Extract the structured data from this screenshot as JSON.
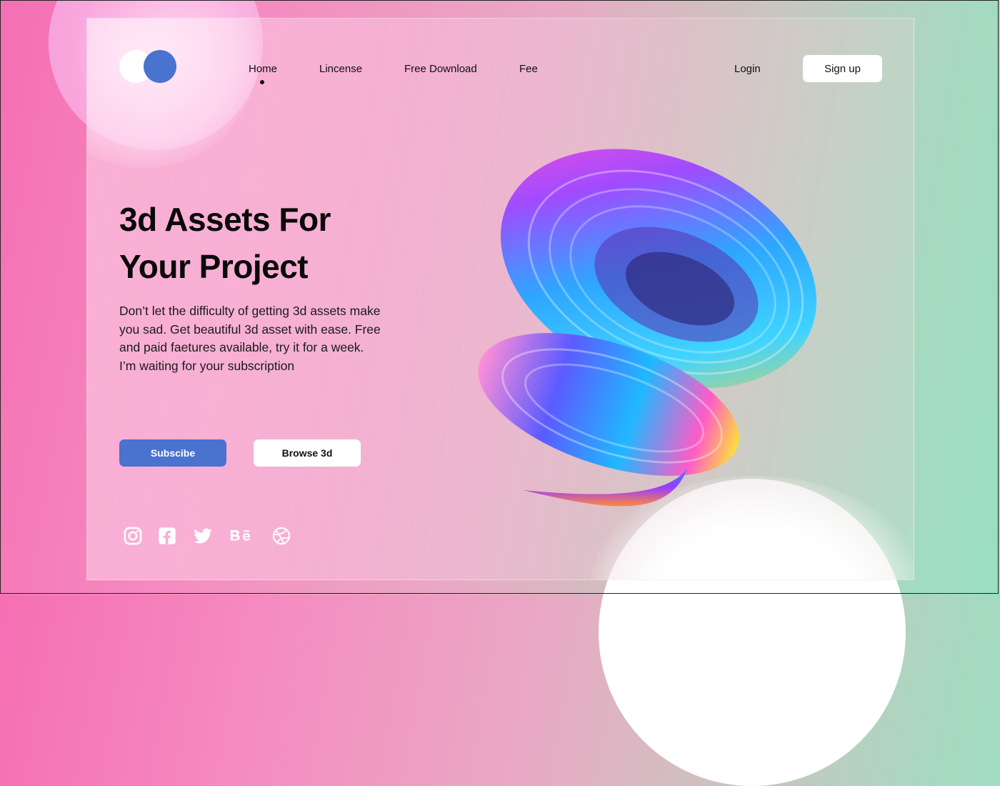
{
  "logo": {
    "icon": "two-circles-logo",
    "colors": {
      "primary": "#4a72cf",
      "secondary": "#ffffff"
    }
  },
  "nav": {
    "items": [
      {
        "label": "Home",
        "active": true
      },
      {
        "label": "Lincense",
        "active": false
      },
      {
        "label": "Free Download",
        "active": false
      },
      {
        "label": "Fee",
        "active": false
      }
    ],
    "login": "Login",
    "signup": "Sign up"
  },
  "hero": {
    "headline_line1": "3d Assets For",
    "headline_line2": "Your Project",
    "description": "Don’t let the difficulty of getting 3d assets make you sad. Get beautiful 3d asset with ease. Free and paid faetures available, try it for a week. I’m waiting for your subscription",
    "primary_button": "Subscibe",
    "secondary_button": "Browse 3d",
    "illustration_icon": "abstract-3d-swirl"
  },
  "socials": [
    {
      "icon": "instagram-icon"
    },
    {
      "icon": "facebook-icon"
    },
    {
      "icon": "twitter-icon"
    },
    {
      "icon": "behance-icon"
    },
    {
      "icon": "dribbble-icon"
    }
  ],
  "colors": {
    "accent": "#4a72cf",
    "text": "#0a0a0a",
    "button_light": "#ffffff"
  }
}
